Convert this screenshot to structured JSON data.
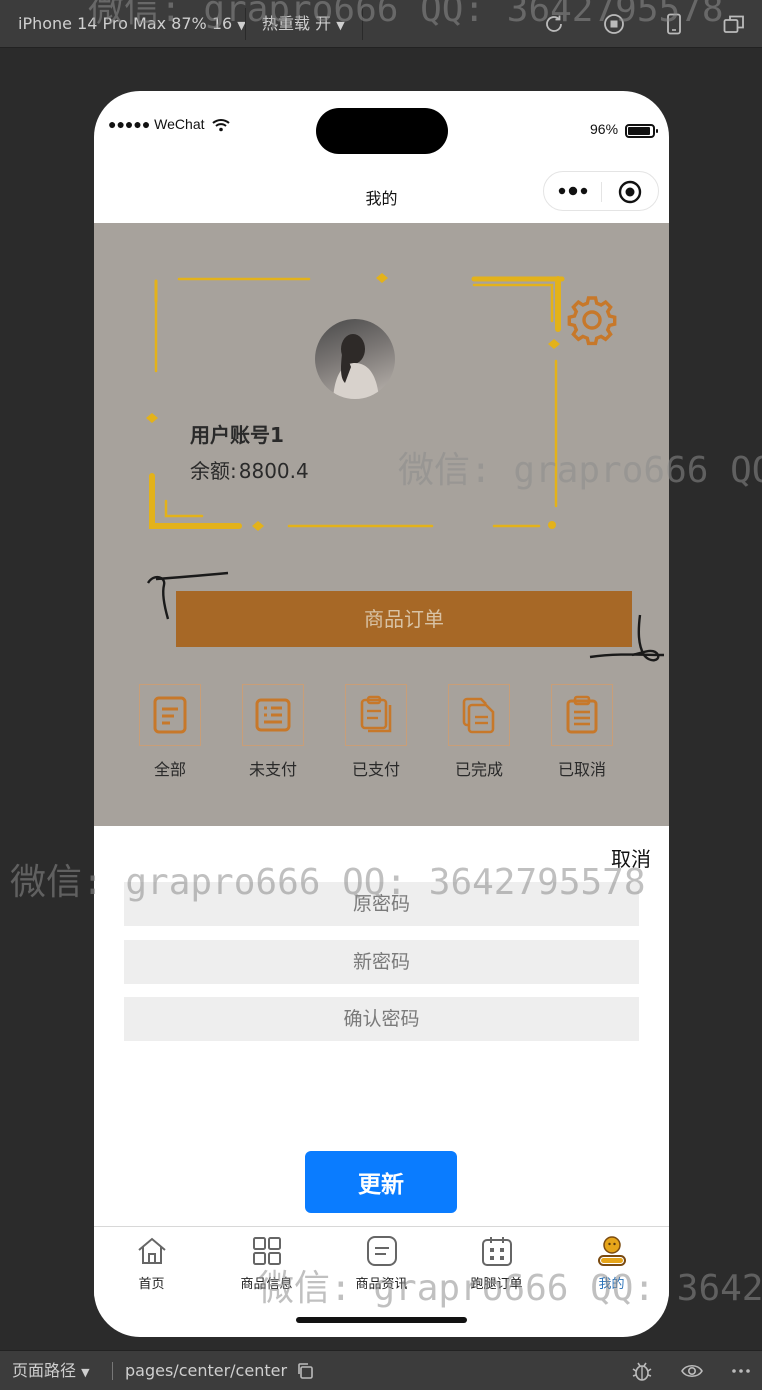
{
  "devbar": {
    "device": "iPhone 14 Pro Max 87% 16",
    "hot_reload": "热重载 开"
  },
  "ios_status": {
    "carrier": "●●●●● WeChat",
    "battery": "96%"
  },
  "navbar": {
    "title": "我的"
  },
  "profile": {
    "username": "用户账号1",
    "balance_label": "余额:",
    "balance_value": "8800.4"
  },
  "order_banner": "商品订单",
  "order_categories": [
    {
      "label": "全部",
      "icon": "doc-list-icon"
    },
    {
      "label": "未支付",
      "icon": "doc-lines-icon"
    },
    {
      "label": "已支付",
      "icon": "clipboard-icon"
    },
    {
      "label": "已完成",
      "icon": "copy-doc-icon"
    },
    {
      "label": "已取消",
      "icon": "clipboard-list-icon"
    }
  ],
  "sheet": {
    "cancel": "取消",
    "old_password_placeholder": "原密码",
    "new_password_placeholder": "新密码",
    "confirm_password_placeholder": "确认密码",
    "update": "更新"
  },
  "tabbar": [
    {
      "label": "首页",
      "icon": "home-icon"
    },
    {
      "label": "商品信息",
      "icon": "grid-icon"
    },
    {
      "label": "商品资讯",
      "icon": "news-icon"
    },
    {
      "label": "跑腿订单",
      "icon": "calendar-icon"
    },
    {
      "label": "我的",
      "icon": "profile-icon",
      "active": true
    }
  ],
  "statusbar": {
    "path_label": "页面路径",
    "path": "pages/center/center"
  },
  "watermarks": {
    "top": "微信: grapro666 QQ: 3642795578",
    "profile": "微信: grapro666 QQ",
    "sheet": "微信: grapro666 QQ: 3642795578",
    "tabbar": "微信: grapro666 QQ: 3642"
  },
  "colors": {
    "accent_blue": "#0a7cff",
    "banner_brown": "#a76826",
    "overlay": "#a7a29c",
    "gold": "#e3b21a"
  }
}
